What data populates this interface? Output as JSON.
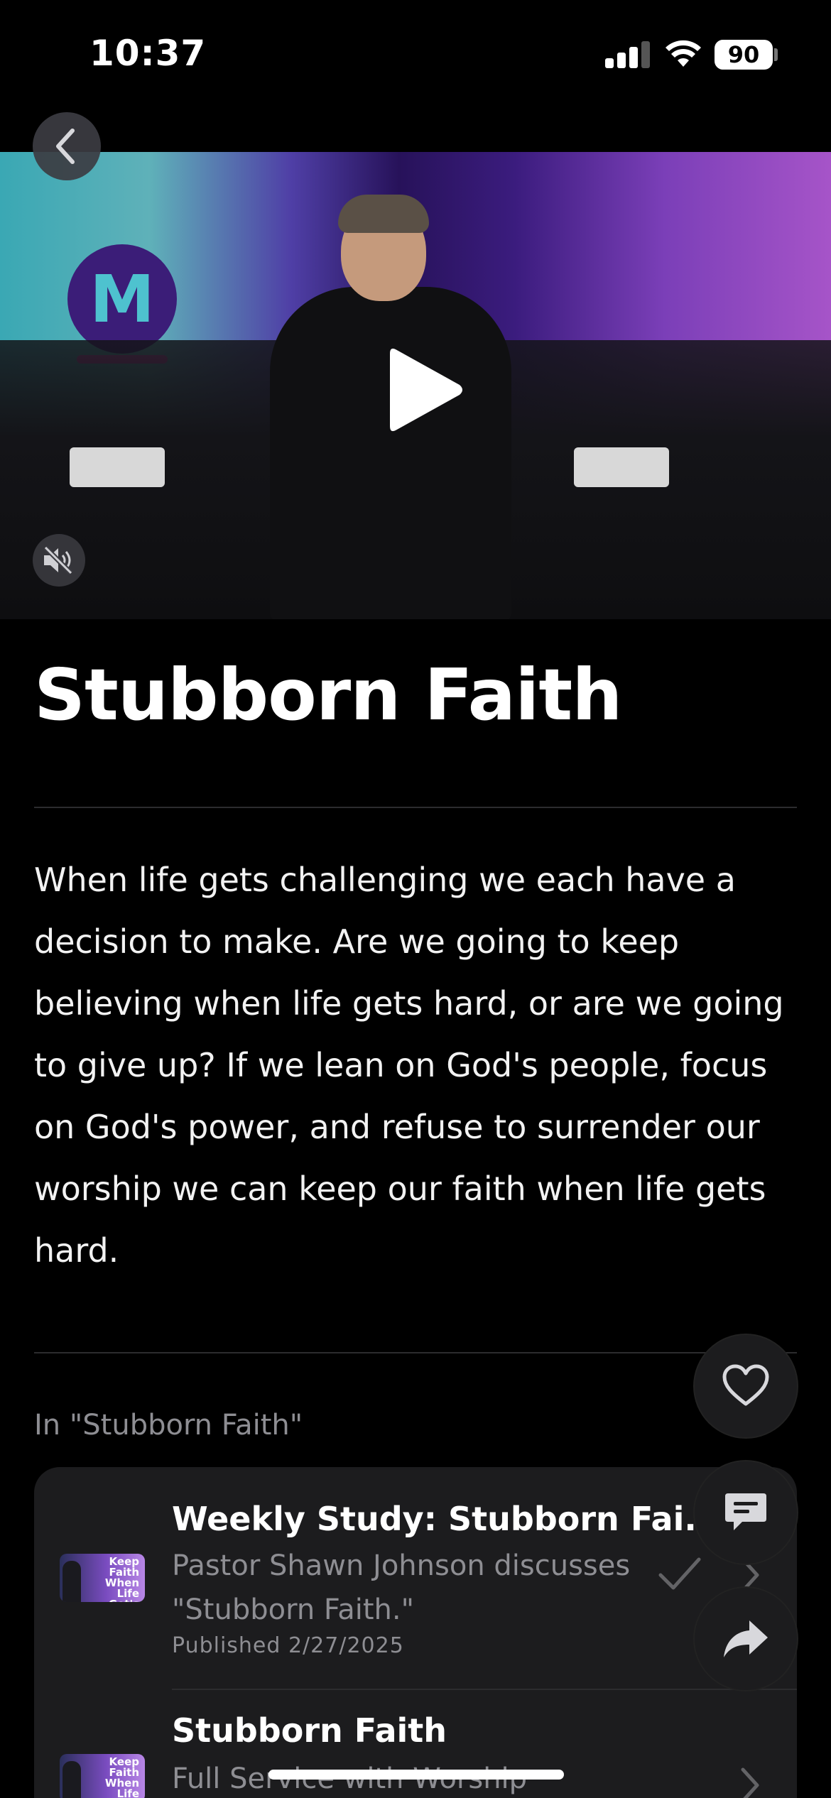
{
  "status_bar": {
    "time": "10:37",
    "battery": "90"
  },
  "video": {
    "logo_letter": "M"
  },
  "page_title": "Stubborn Faith",
  "description": "When life gets challenging we each have a decision to make. Are we going to keep believing when life gets hard, or are we going to give up? If we lean on God's people, focus on God's power, and refuse to surrender our worship we can keep our faith when life gets hard.",
  "series_heading": "In \"Stubborn Faith\"",
  "items": [
    {
      "thumb_text": "Keep Faith When Life Get's Hard",
      "title": "Weekly Study: Stubborn Fai...",
      "subtitle": "Pastor Shawn Johnson discusses \"Stubborn Faith.\"",
      "date": "Published 2/27/2025",
      "watched": true
    },
    {
      "thumb_text": "Keep Faith When Life Get's Hard",
      "title": "Stubborn Faith",
      "subtitle": "Full Service with Worship",
      "watched": false
    }
  ],
  "icons": {
    "back": "chevron-left-icon",
    "play": "play-icon",
    "mute": "speaker-muted-icon",
    "like": "heart-icon",
    "comment": "chat-bubble-icon",
    "share": "share-arrow-icon"
  }
}
